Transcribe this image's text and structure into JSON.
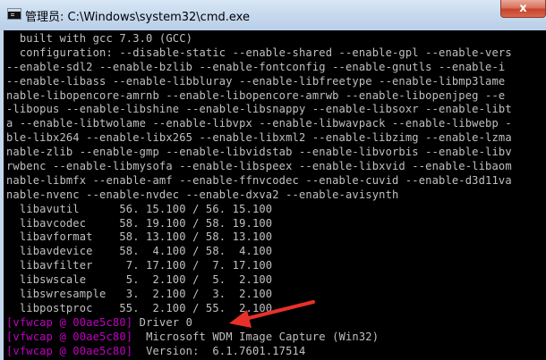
{
  "window": {
    "title": "管理员: C:\\Windows\\system32\\cmd.exe",
    "close_label": "x"
  },
  "console": {
    "lines": [
      {
        "prefix": "",
        "text": "  built with gcc 7.3.0 (GCC)"
      },
      {
        "prefix": "",
        "text": "  configuration: --disable-static --enable-shared --enable-gpl --enable-vers"
      },
      {
        "prefix": "",
        "text": "--enable-sdl2 --enable-bzlib --enable-fontconfig --enable-gnutls --enable-i"
      },
      {
        "prefix": "",
        "text": "--enable-libass --enable-libbluray --enable-libfreetype --enable-libmp3lame"
      },
      {
        "prefix": "",
        "text": "nable-libopencore-amrnb --enable-libopencore-amrwb --enable-libopenjpeg --e"
      },
      {
        "prefix": "",
        "text": "-libopus --enable-libshine --enable-libsnappy --enable-libsoxr --enable-libt"
      },
      {
        "prefix": "",
        "text": "a --enable-libtwolame --enable-libvpx --enable-libwavpack --enable-libwebp -"
      },
      {
        "prefix": "",
        "text": "ble-libx264 --enable-libx265 --enable-libxml2 --enable-libzimg --enable-lzma"
      },
      {
        "prefix": "",
        "text": "nable-zlib --enable-gmp --enable-libvidstab --enable-libvorbis --enable-libv"
      },
      {
        "prefix": "",
        "text": "rwbenc --enable-libmysofa --enable-libspeex --enable-libxvid --enable-libaom"
      },
      {
        "prefix": "",
        "text": "nable-libmfx --enable-amf --enable-ffnvcodec --enable-cuvid --enable-d3d11va"
      },
      {
        "prefix": "",
        "text": "nable-nvenc --enable-nvdec --enable-dxva2 --enable-avisynth"
      },
      {
        "prefix": "",
        "text": "  libavutil      56. 15.100 / 56. 15.100"
      },
      {
        "prefix": "",
        "text": "  libavcodec     58. 19.100 / 58. 19.100"
      },
      {
        "prefix": "",
        "text": "  libavformat    58. 13.100 / 58. 13.100"
      },
      {
        "prefix": "",
        "text": "  libavdevice    58.  4.100 / 58.  4.100"
      },
      {
        "prefix": "",
        "text": "  libavfilter     7. 17.100 /  7. 17.100"
      },
      {
        "prefix": "",
        "text": "  libswscale      5.  2.100 /  5.  2.100"
      },
      {
        "prefix": "",
        "text": "  libswresample   3.  2.100 /  3.  2.100"
      },
      {
        "prefix": "",
        "text": "  libpostproc    55.  2.100 / 55.  2.100"
      },
      {
        "prefix": "[vfwcap @ 00ae5c80]",
        "text": " Driver 0"
      },
      {
        "prefix": "[vfwcap @ 00ae5c80]",
        "text": "  Microsoft WDM Image Capture (Win32)"
      },
      {
        "prefix": "[vfwcap @ 00ae5c80]",
        "text": "  Version:  6.1.7601.17514"
      }
    ]
  },
  "annotation": {
    "arrow_color": "#e8302a"
  },
  "colors": {
    "console_bg": "#000000",
    "console_text": "#c0c0c0",
    "prefix": "#c000c0"
  }
}
